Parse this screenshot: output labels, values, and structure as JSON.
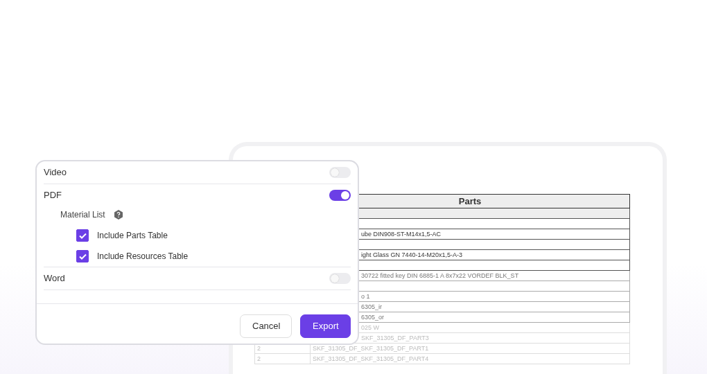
{
  "document": {
    "table": {
      "title": "Parts",
      "rows": [
        {
          "kind": "band"
        },
        {
          "kind": "blank"
        },
        {
          "kind": "partly_hidden",
          "column_2": "ube DIN908-ST-M14x1,5-AC"
        },
        {
          "kind": "blank"
        },
        {
          "kind": "partly_hidden",
          "column_2": "ight Glass GN 7440-14-M20x1,5-A-3"
        },
        {
          "kind": "blank"
        },
        {
          "kind": "partly_hidden",
          "column_2": "30722 fitted key DIN 6885-1 A 8x7x22 VORDEF BLK_ST"
        },
        {
          "kind": "blank"
        },
        {
          "kind": "partly_hidden",
          "column_2": "o 1"
        },
        {
          "kind": "partly_hidden",
          "column_2": "6305_ir"
        },
        {
          "kind": "partly_hidden",
          "column_2": "6305_or"
        },
        {
          "kind": "partly_hidden",
          "column_2": "025 W"
        },
        {
          "kind": "partly_hidden",
          "column_2": "SKF_31305_DF_PART3"
        },
        {
          "kind": "full",
          "column_1": "2",
          "column_2": "SKF_31305_DF_SKF_31305_DF_PART1"
        },
        {
          "kind": "full",
          "column_1": "2",
          "column_2": "SKF_31305_DF_SKF_31305_DF_PART4"
        }
      ]
    }
  },
  "dialog": {
    "options": [
      {
        "label": "Video",
        "on": false
      },
      {
        "label": "PDF",
        "on": true,
        "section": {
          "label": "Material List",
          "checkboxes": [
            {
              "label": "Include Parts Table",
              "checked": true
            },
            {
              "label": "Include Resources Table",
              "checked": true
            }
          ]
        }
      },
      {
        "label": "Word",
        "on": false
      }
    ],
    "buttons": [
      {
        "label": "Cancel",
        "kind": "secondary"
      },
      {
        "label": "Export",
        "kind": "primary"
      }
    ]
  }
}
